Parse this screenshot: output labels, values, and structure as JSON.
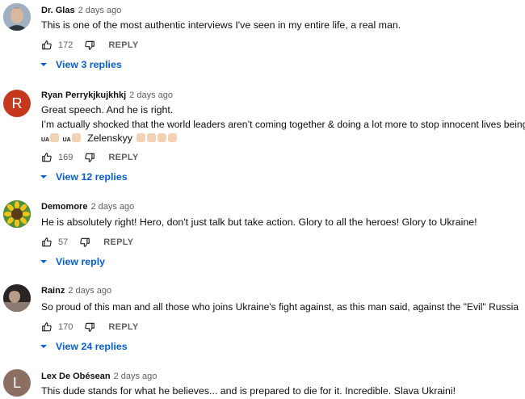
{
  "comments": [
    {
      "author": "Dr. Glas",
      "time": "2 days ago",
      "text": [
        "This is one of the most authentic interviews I've seen in my entire life, a real man."
      ],
      "likes": "172",
      "reply_label": "REPLY",
      "replies_label": "View 3 replies",
      "avatar": {
        "type": "photo",
        "color": "#6b7e92"
      }
    },
    {
      "author": "Ryan Perrykjkujkhkj",
      "time": "2 days ago",
      "text": [
        "Great speech. And he is right.",
        "I’m actually shocked that the world leaders aren’t coming together & doing a lot more to stop innocent lives being lost"
      ],
      "text_extra": {
        "flag1": "UA",
        "flag2": "UA",
        "name": "Zelenskyy"
      },
      "likes": "169",
      "reply_label": "REPLY",
      "replies_label": "View 12 replies",
      "avatar": {
        "type": "letter",
        "letter": "R",
        "color": "#c6381d"
      }
    },
    {
      "author": "Demomore",
      "time": "2 days ago",
      "text": [
        "He is absolutely right! Hero, don't just talk but take action. Glory to all the heroes! Glory to Ukraine!"
      ],
      "likes": "57",
      "reply_label": "REPLY",
      "replies_label": "View reply",
      "avatar": {
        "type": "sunflower",
        "color": "#e4b21c"
      }
    },
    {
      "author": "Rainz",
      "time": "2 days ago",
      "text": [
        "So proud of this man and all those who joins Ukraine's fight against, as this man said,  against the \"Evil\" Russia"
      ],
      "likes": "170",
      "reply_label": "REPLY",
      "replies_label": "View 24 replies",
      "avatar": {
        "type": "photo-dark",
        "color": "#3a3030"
      }
    },
    {
      "author": "Lex De Obésean",
      "time": "2 days ago",
      "text": [
        "This dude stands for what he believes... and is prepared to die for it. Incredible. Slava Ukraini!"
      ],
      "avatar": {
        "type": "letter",
        "letter": "L",
        "color": "#8d6e63"
      }
    }
  ],
  "colors": {
    "link": "#065fd4",
    "meta": "#606060",
    "text": "#0f0f0f"
  },
  "icons": {
    "like": "thumb-up-icon",
    "dislike": "thumb-down-icon",
    "expand": "chevron-down-icon"
  }
}
